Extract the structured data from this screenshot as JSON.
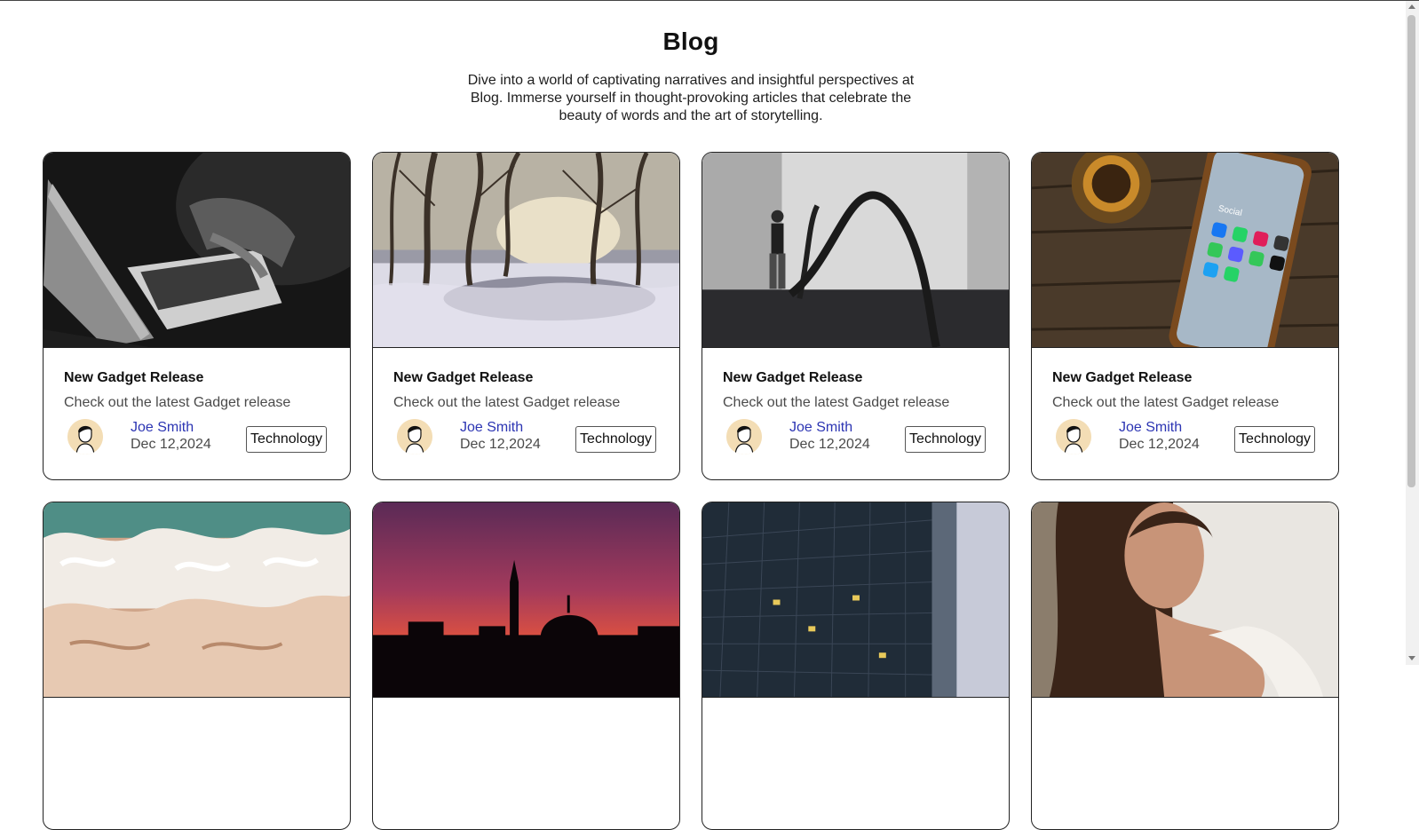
{
  "header": {
    "title": "Blog",
    "intro": "Dive into a world of captivating narratives and insightful perspectives at Blog. Immerse yourself in thought-provoking articles that celebrate the beauty of words and the art of storytelling."
  },
  "cards": [
    {
      "image": "laptop-typing-photo",
      "title": "New Gadget Release",
      "text": "Check out the latest Gadget release",
      "author": "Joe Smith",
      "date": "Dec 12,2024",
      "tag": "Technology"
    },
    {
      "image": "snowy-forest-photo",
      "title": "New Gadget Release",
      "text": "Check out the latest Gadget release",
      "author": "Joe Smith",
      "date": "Dec 12,2024",
      "tag": "Technology"
    },
    {
      "image": "battle-ropes-photo",
      "title": "New Gadget Release",
      "text": "Check out the latest Gadget release",
      "author": "Joe Smith",
      "date": "Dec 12,2024",
      "tag": "Technology"
    },
    {
      "image": "phone-social-apps-photo",
      "title": "New Gadget Release",
      "text": "Check out the latest Gadget release",
      "author": "Joe Smith",
      "date": "Dec 12,2024",
      "tag": "Technology"
    },
    {
      "image": "sea-foam-photo"
    },
    {
      "image": "mosque-sunset-photo"
    },
    {
      "image": "building-facade-photo"
    },
    {
      "image": "woman-portrait-photo"
    }
  ],
  "colors": {
    "author_link": "#2c35b3",
    "avatar_bg": "#f3ddb5",
    "border": "#222222"
  }
}
